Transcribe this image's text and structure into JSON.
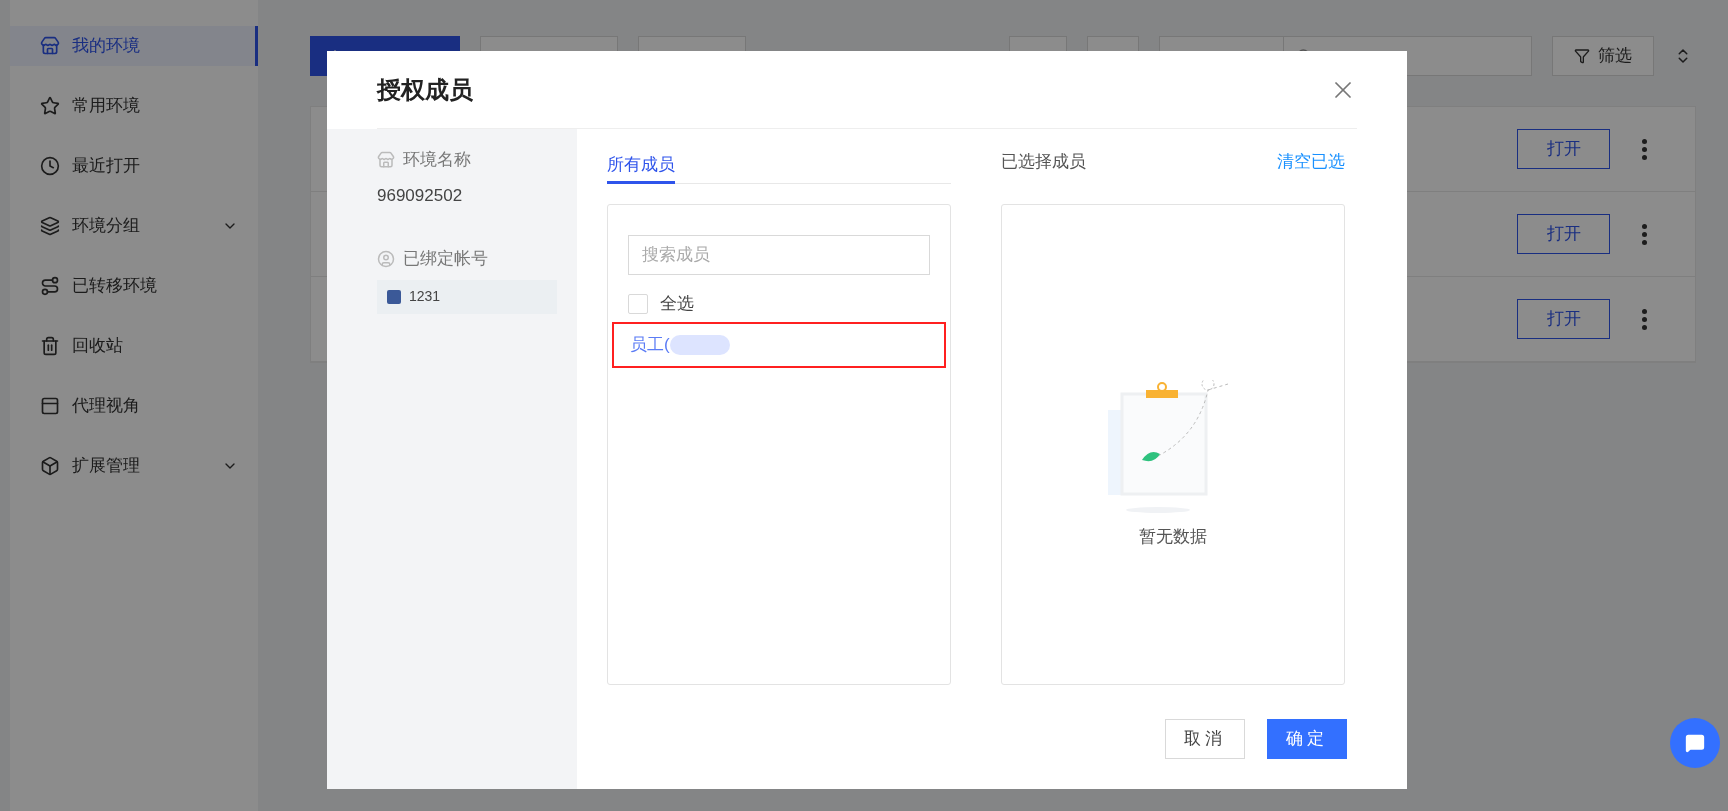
{
  "sidebar": {
    "items": [
      {
        "label": "我的环境",
        "selected": true,
        "kind": "link"
      },
      {
        "label": "常用环境",
        "selected": false,
        "kind": "link"
      },
      {
        "label": "最近打开",
        "selected": false,
        "kind": "link"
      },
      {
        "label": "环境分组",
        "selected": false,
        "kind": "group"
      },
      {
        "label": "已转移环境",
        "selected": false,
        "kind": "link"
      },
      {
        "label": "回收站",
        "selected": false,
        "kind": "link"
      },
      {
        "label": "代理视角",
        "selected": false,
        "kind": "link"
      },
      {
        "label": "扩展管理",
        "selected": false,
        "kind": "group"
      }
    ]
  },
  "toolbar": {
    "filter_button": "筛选"
  },
  "rows": [
    {
      "action": "打开"
    },
    {
      "action": "打开"
    },
    {
      "action": "打开"
    }
  ],
  "dialog": {
    "title": "授权成员",
    "env_label": "环境名称",
    "env_name": "969092502",
    "account_label": "已绑定帐号",
    "account": "1231",
    "tabs": [
      {
        "label": "所有成员",
        "selected": true
      }
    ],
    "search": {
      "placeholder": "搜索成员"
    },
    "select_all": {
      "label": "全选",
      "checked": false
    },
    "members": [
      {
        "label": "员工(",
        "highlighted": true
      }
    ],
    "selected_title": "已选择成员",
    "clear_link": "清空已选",
    "empty_text": "暂无数据",
    "cancel": "取消",
    "confirm": "确定"
  }
}
